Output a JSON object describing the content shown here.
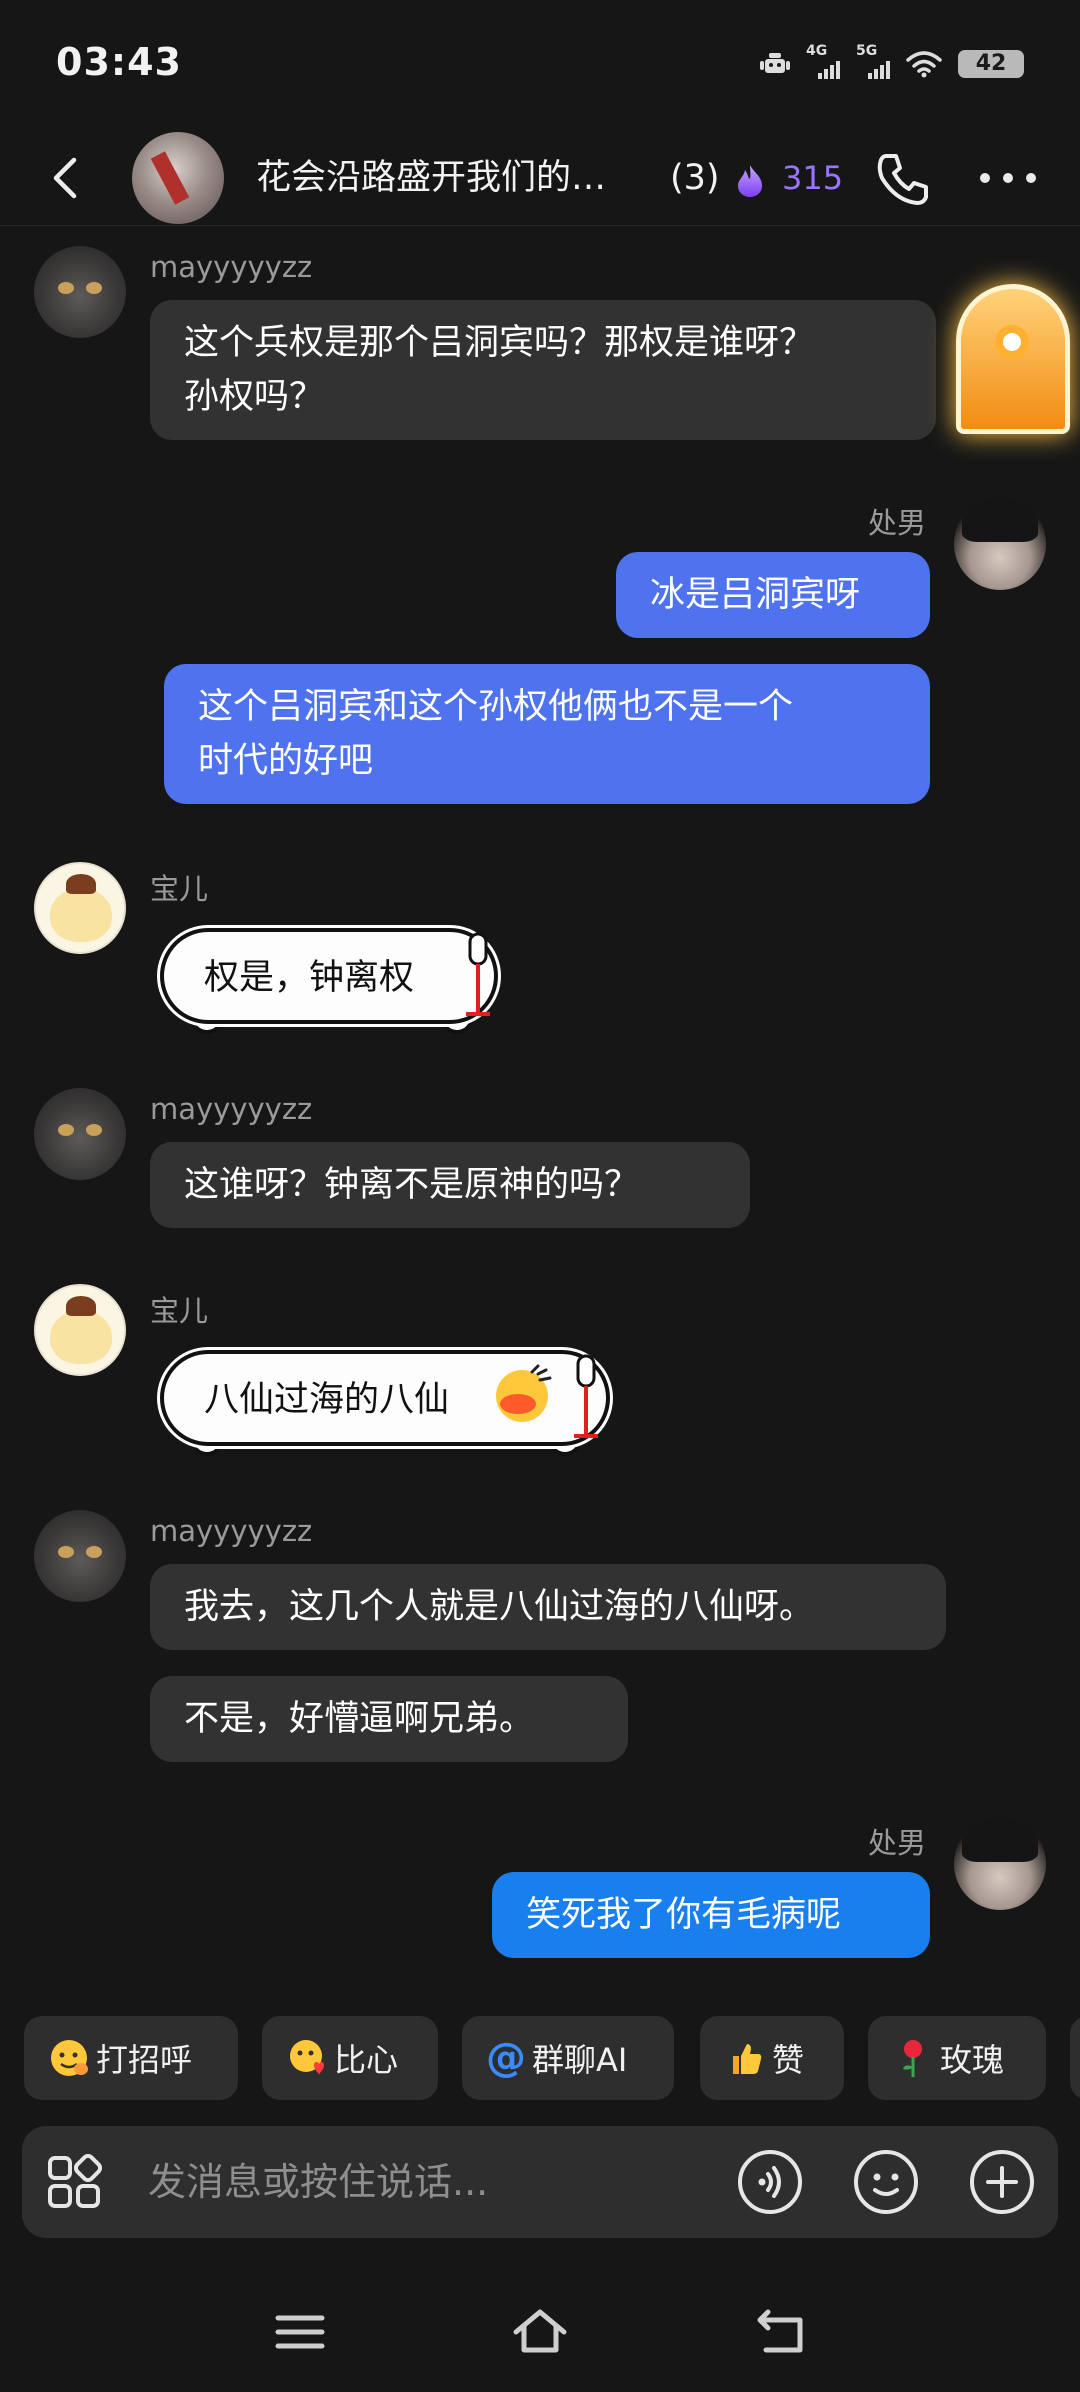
{
  "status_bar": {
    "time": "03:43",
    "net1": "4G",
    "net2": "5G",
    "battery": "42"
  },
  "header": {
    "title": "花会沿路盛开我们的…",
    "member_count": "(3)",
    "streak": "315"
  },
  "messages": {
    "m1": {
      "sender": "mayyyyyzz",
      "text1": "这个兵权是那个吕洞宾吗？那权是谁呀？",
      "text2": "孙权吗？"
    },
    "m2": {
      "sender": "处男",
      "text": "冰是吕洞宾呀"
    },
    "m3": {
      "text1": "这个吕洞宾和这个孙权他俩也不是一个",
      "text2": "时代的好吧"
    },
    "m4": {
      "sender": "宝儿",
      "text": "权是，钟离权"
    },
    "m5": {
      "sender": "mayyyyyzz",
      "text": "这谁呀？钟离不是原神的吗？"
    },
    "m6": {
      "sender": "宝儿",
      "text": "八仙过海的八仙"
    },
    "m7": {
      "sender": "mayyyyyzz",
      "text": "我去，这几个人就是八仙过海的八仙呀。"
    },
    "m8": {
      "text": "不是，好懵逼啊兄弟。"
    },
    "m9": {
      "sender": "处男",
      "text": "笑死我了你有毛病呢"
    }
  },
  "quick_replies": [
    {
      "label": "打招呼",
      "icon": "wave-emoji-icon"
    },
    {
      "label": "比心",
      "icon": "heart-hands-emoji-icon"
    },
    {
      "label": "群聊AI",
      "icon": "at-icon"
    },
    {
      "label": "赞",
      "icon": "thumbs-up-icon"
    },
    {
      "label": "玫瑰",
      "icon": "rose-icon"
    }
  ],
  "input": {
    "placeholder": "发消息或按住说话..."
  },
  "colors": {
    "background": "#161616",
    "bubble_gray": "#323232",
    "bubble_blue": "#4f72ee",
    "bubble_blue_last": "#1a7fee",
    "accent_purple": "#9a74ff"
  }
}
